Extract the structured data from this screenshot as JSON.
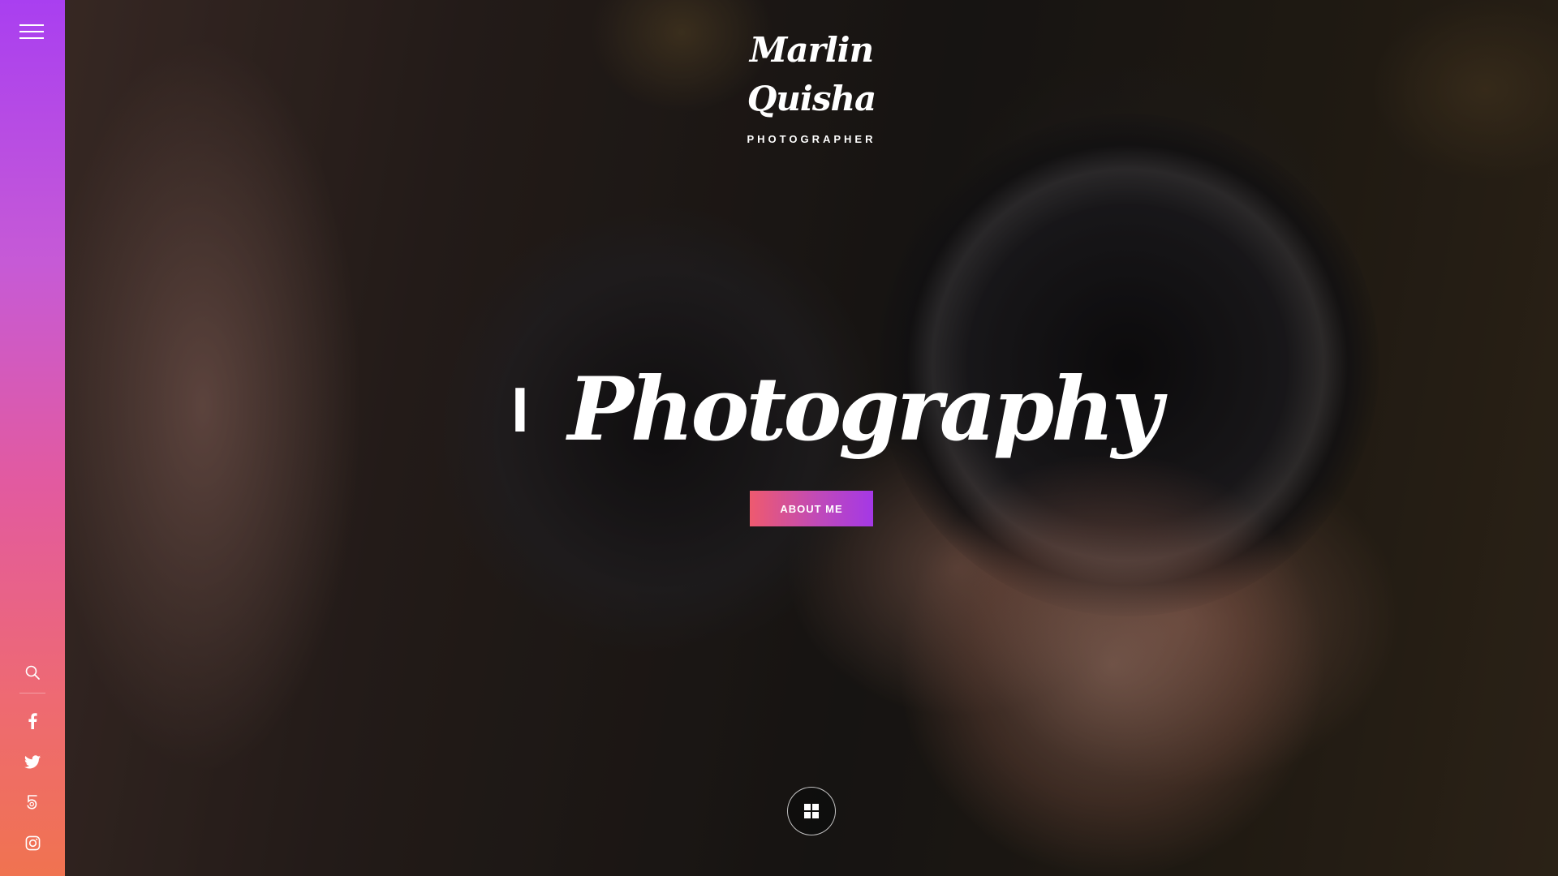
{
  "brand": {
    "name": "Marlin Quisha",
    "tagline": "PHOTOGRAPHER"
  },
  "hero": {
    "headline_prefix": "I",
    "headline_icon": "heart-outline-icon",
    "headline_word": "Photography",
    "cta_label": "ABOUT ME"
  },
  "sidebar": {
    "menu_icon": "hamburger-menu-icon",
    "search_icon": "search-icon",
    "social": [
      "facebook-icon",
      "twitter-icon",
      "500px-icon",
      "instagram-icon"
    ]
  },
  "gallery_button_icon": "grid-icon",
  "colors": {
    "sidebar_top": "#a93ff0",
    "sidebar_bottom": "#f07350",
    "heart": "#e8174f",
    "button_start": "#ee5a6f",
    "button_end": "#a438e6"
  }
}
